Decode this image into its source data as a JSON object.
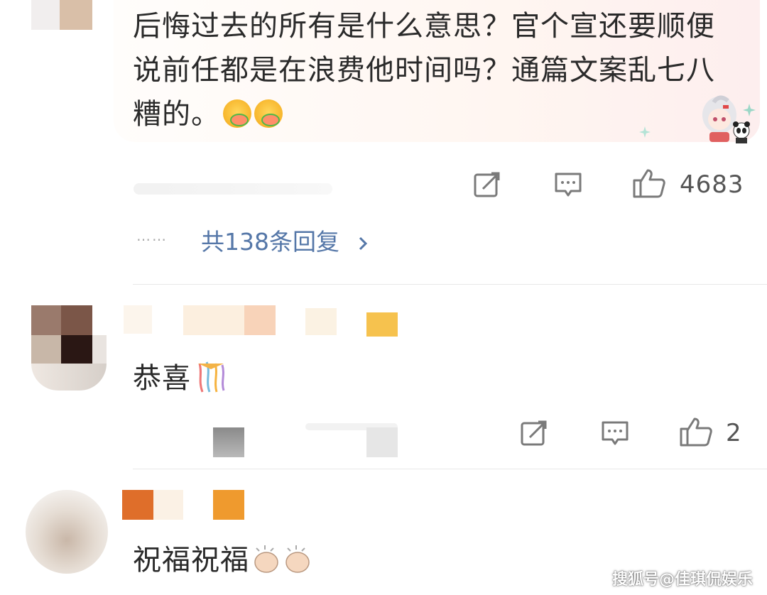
{
  "comment1": {
    "text": "后悔过去的所有是什么意思？官个宣还要顺便说前任都是在浪费他时间吗？通篇文案乱七八糟的。",
    "emojis": [
      "yummy-face-icon",
      "yummy-face-icon"
    ],
    "likes": "4683",
    "replies_label": "共138条回复",
    "replies_dots": "……"
  },
  "comment2": {
    "text": "恭喜",
    "emoji": "party-popper-icon",
    "likes": "2"
  },
  "comment3": {
    "text": "祝福祝福",
    "emoji": "clapping-hands-icon"
  },
  "watermark": "搜狐号@佳琪侃娱乐",
  "colors": {
    "link": "#5577a8",
    "icon": "#7a7a7a",
    "text": "#2a2a2a"
  }
}
